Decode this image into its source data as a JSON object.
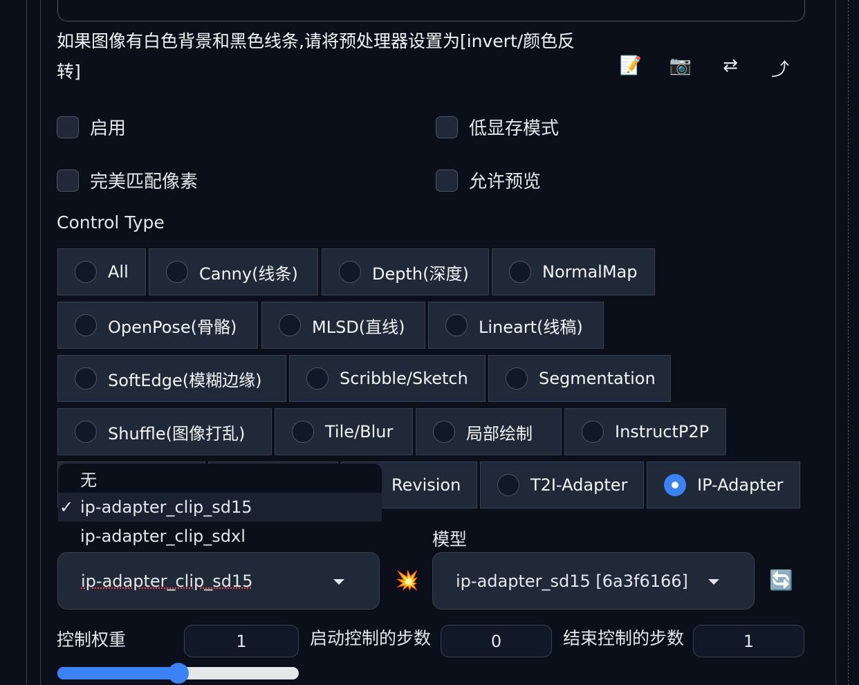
{
  "hint": "如果图像有白色背景和黑色线条,请将预处理器设置为[invert/颜色反转]",
  "tools": [
    {
      "icon": "memo-icon",
      "glyph": "📝"
    },
    {
      "icon": "camera-icon",
      "glyph": "📷"
    },
    {
      "icon": "swap-icon",
      "glyph": "⇄"
    },
    {
      "icon": "upload-arrow-icon",
      "glyph": "⤴"
    }
  ],
  "checkboxes": {
    "enable": "启用",
    "low_vram": "低显存模式",
    "pixel_perfect": "完美匹配像素",
    "allow_preview": "允许预览"
  },
  "control_type": {
    "label": "Control Type",
    "options": [
      "All",
      "Canny(线条)",
      "Depth(深度)",
      "NormalMap",
      "OpenPose(骨骼)",
      "MLSD(直线)",
      "Lineart(线稿)",
      "SoftEdge(模糊边缘)",
      "Scribble/Sketch",
      "Segmentation",
      "Shuffle(图像打乱)",
      "Tile/Blur",
      "局部绘制",
      "InstructP2P",
      "",
      "",
      "Revision",
      "T2I-Adapter",
      "IP-Adapter"
    ],
    "selected": "IP-Adapter"
  },
  "preprocessor": {
    "value": "ip-adapter_clip_sd15",
    "options": [
      "无",
      "ip-adapter_clip_sd15",
      "ip-adapter_clip_sdxl"
    ],
    "check": "✓"
  },
  "run_icon": "💥",
  "model": {
    "label": "模型",
    "value": "ip-adapter_sd15 [6a3f6166]",
    "refresh_icon": "🔄"
  },
  "weight": {
    "label": "控制权重",
    "value": "1",
    "fraction": 0.5
  },
  "start": {
    "label": "启动控制的步数",
    "value": "0"
  },
  "end": {
    "label": "结束控制的步数",
    "value": "1"
  },
  "accent": "#3b82f6"
}
